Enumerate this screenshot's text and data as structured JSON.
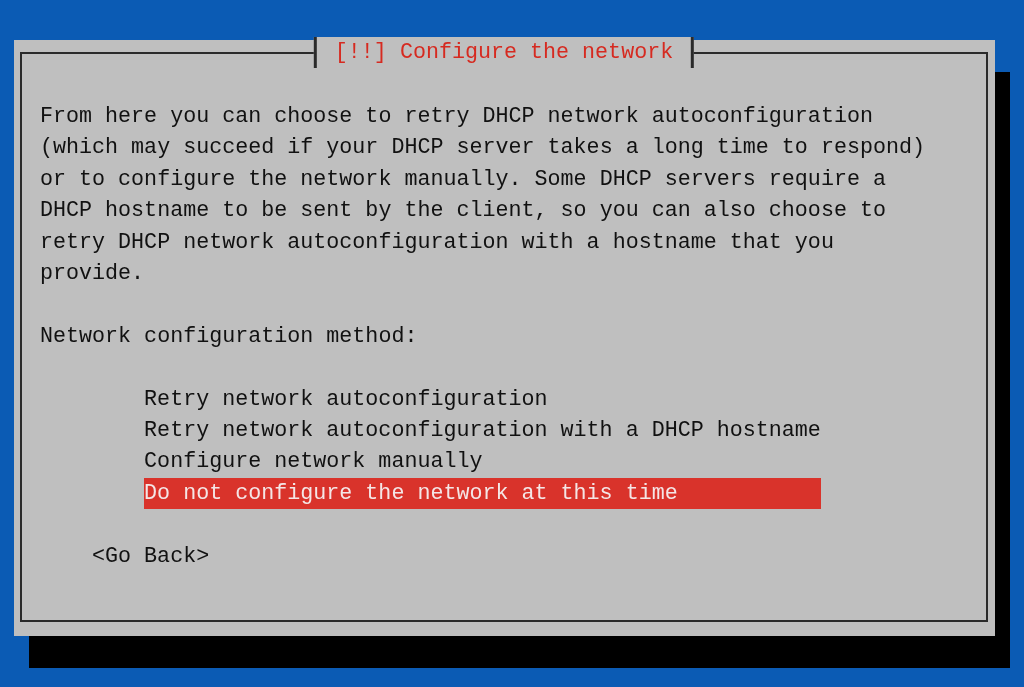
{
  "dialog": {
    "title": "[!!] Configure the network",
    "description": "From here you can choose to retry DHCP network autoconfiguration (which may succeed if your DHCP server takes a long time to respond) or to configure the network manually. Some DHCP servers require a DHCP hostname to be sent by the client, so you can also choose to retry DHCP network autoconfiguration with a hostname that you provide.",
    "prompt": "Network configuration method:",
    "options": [
      {
        "label": "Retry network autoconfiguration",
        "selected": false
      },
      {
        "label": "Retry network autoconfiguration with a DHCP hostname",
        "selected": false
      },
      {
        "label": "Configure network manually",
        "selected": false
      },
      {
        "label": "Do not configure the network at this time",
        "selected": true
      }
    ],
    "back_button": "<Go Back>"
  }
}
